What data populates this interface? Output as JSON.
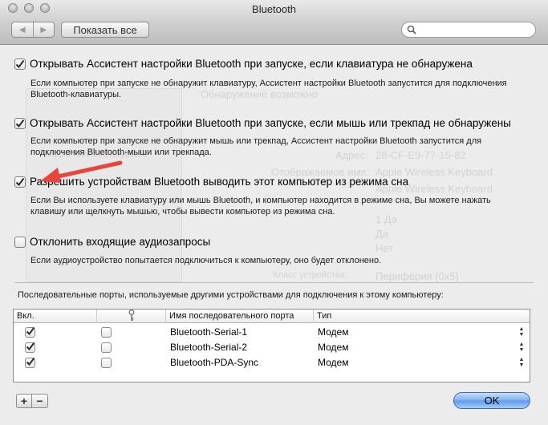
{
  "window": {
    "title": "Bluetooth"
  },
  "toolbar": {
    "back_label": "◀",
    "forward_label": "▶",
    "show_all_label": "Показать все",
    "search_placeholder": ""
  },
  "background_ghost": {
    "status": "Обнаружение возможно",
    "list_item": "Apple Wireless Keyboard",
    "address_label": "Адрес:",
    "address_value": "28-CF-E9-77-15-82",
    "name_label": "Отображаемое имя:",
    "name_value": "Apple Wireless Keyboard",
    "type_value": "Apple Wireless Keyboard",
    "yes1": "1 Да",
    "yes2": "Да",
    "no": "Нет",
    "class_label": "Класс устройства:",
    "class_value": "Периферия (0x5)"
  },
  "options": [
    {
      "label": "Открывать Ассистент настройки Bluetooth при запуске, если клавиатура не обнаружена",
      "checked": true,
      "description": "Если компьютер при запуске не обнаружит клавиатуру, Ассистент настройки Bluetooth запустится для подключения Bluetooth-клавиатуры."
    },
    {
      "label": "Открывать Ассистент настройки Bluetooth при запуске, если мышь или трекпад не обнаружены",
      "checked": true,
      "description": "Если компьютер при запуске не обнаружит мышь или трекпад, Ассистент настройки Bluetooth запустится для подключения Bluetooth-мыши или трекпада."
    },
    {
      "label": "Разрешить устройствам Bluetooth выводить этот компьютер из режима сна",
      "checked": true,
      "description": "Если Вы используете клавиатуру или мышь Bluetooth, и компьютер находится в режиме сна, Вы можете нажать клавишу или щелкнуть мышью, чтобы вывести компьютер из режима сна."
    },
    {
      "label": "Отклонить входящие аудиозапросы",
      "checked": false,
      "description": "Если аудиоустройство попытается подключиться к компьютеру, оно будет отклонено."
    }
  ],
  "ports": {
    "caption": "Последовательные порты, используемые другими устройствами для подключения к этому компьютеру:",
    "columns": [
      "Вкл.",
      "key-icon",
      "Имя последовательного порта",
      "Тип"
    ],
    "rows": [
      {
        "enabled": true,
        "secure": false,
        "name": "Bluetooth-Serial-1",
        "type": "Модем"
      },
      {
        "enabled": true,
        "secure": false,
        "name": "Bluetooth-Serial-2",
        "type": "Модем"
      },
      {
        "enabled": true,
        "secure": false,
        "name": "Bluetooth-PDA-Sync",
        "type": "Модем"
      }
    ]
  },
  "buttons": {
    "add_label": "+",
    "remove_label": "−",
    "ok_label": "OK"
  },
  "colors": {
    "check": "#2b2b2b",
    "arrow": "#e8453c",
    "ok_button": "#6aa6ee"
  }
}
